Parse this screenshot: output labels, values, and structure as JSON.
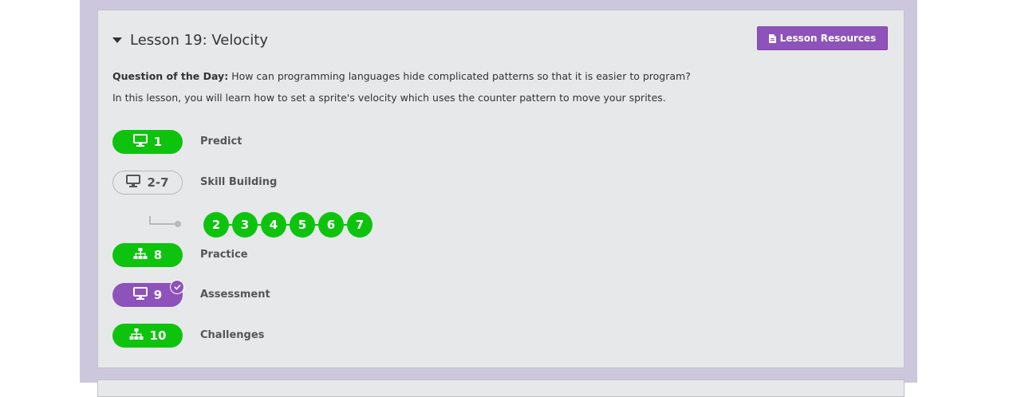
{
  "lesson": {
    "title": "Lesson 19: Velocity",
    "resources_label": "Lesson Resources",
    "question_prefix": "Question of the Day:",
    "question_text": "How can programming languages hide complicated patterns so that it is easier to program?",
    "description": "In this lesson, you will learn how to set a sprite's velocity which uses the counter pattern to move your sprites."
  },
  "levels": [
    {
      "number": "1",
      "label": "Predict",
      "icon": "computer-icon",
      "state": "complete"
    },
    {
      "number": "2-7",
      "label": "Skill Building",
      "icon": "computer-icon",
      "state": "group"
    },
    {
      "number": "8",
      "label": "Practice",
      "icon": "sitemap-icon",
      "state": "complete"
    },
    {
      "number": "9",
      "label": "Assessment",
      "icon": "computer-icon",
      "state": "assessment-complete"
    },
    {
      "number": "10",
      "label": "Challenges",
      "icon": "sitemap-icon",
      "state": "complete"
    }
  ],
  "sublevels": [
    "2",
    "3",
    "4",
    "5",
    "6",
    "7"
  ],
  "colors": {
    "complete": "#0ec30e",
    "assessment": "#8e52bb",
    "background_frame": "#cdc7de",
    "card": "#e7e8ea"
  }
}
